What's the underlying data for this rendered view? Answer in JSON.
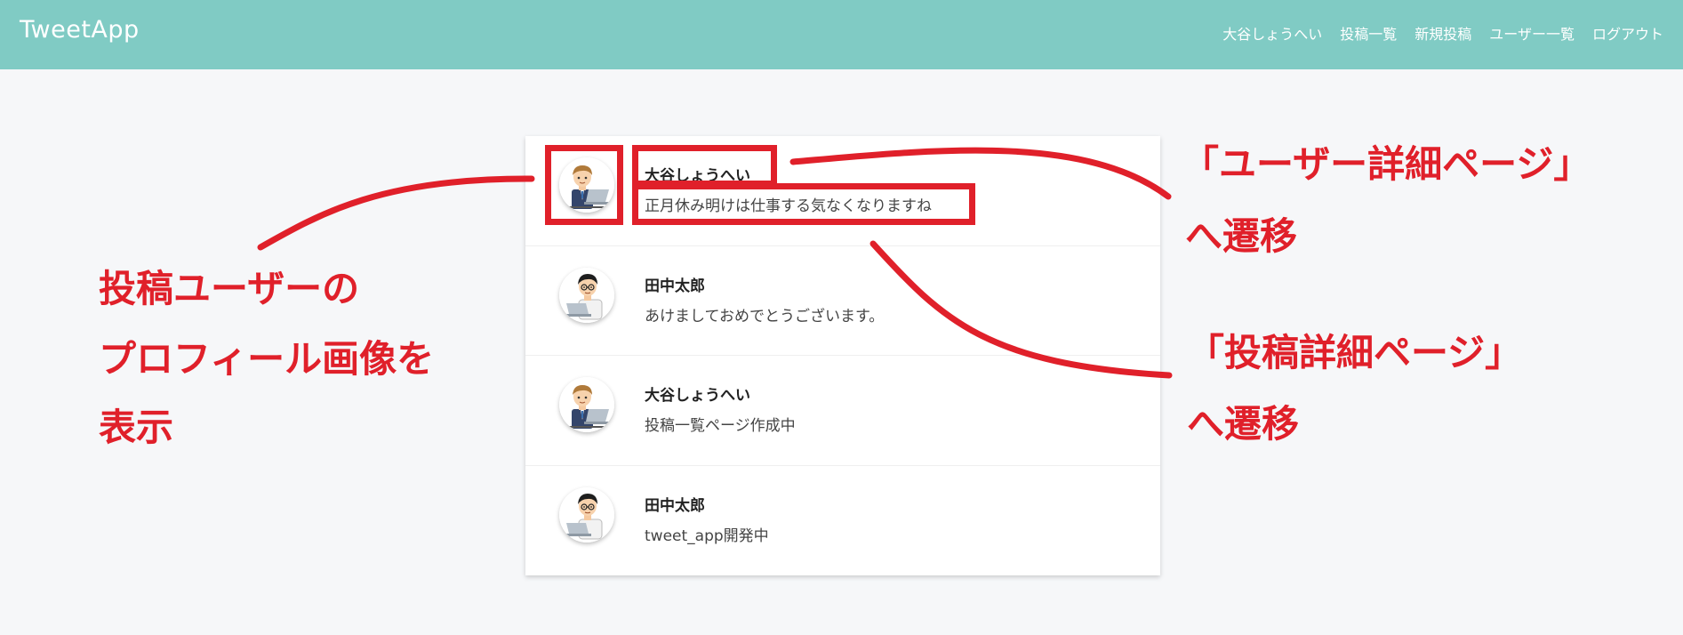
{
  "header": {
    "logo": "TweetApp",
    "nav": [
      "大谷しょうへい",
      "投稿一覧",
      "新規投稿",
      "ユーザー一覧",
      "ログアウト"
    ]
  },
  "posts": [
    {
      "user": "大谷しょうへい",
      "text": "正月休み明けは仕事する気なくなりますね",
      "avatar": "businessman-laptop-avatar"
    },
    {
      "user": "田中太郎",
      "text": "あけましておめでとうございます。",
      "avatar": "glasses-man-laptop-avatar"
    },
    {
      "user": "大谷しょうへい",
      "text": "投稿一覧ページ作成中",
      "avatar": "businessman-laptop-avatar"
    },
    {
      "user": "田中太郎",
      "text": "tweet_app開発中",
      "avatar": "glasses-man-laptop-avatar"
    }
  ],
  "annotations": {
    "left": [
      "投稿ユーザーの",
      "プロフィール画像を",
      "表示"
    ],
    "user_detail": [
      "「ユーザー詳細ページ」",
      "へ遷移"
    ],
    "post_detail": [
      "「投稿詳細ページ」",
      "へ遷移"
    ]
  },
  "colors": {
    "header": "#80cbc4",
    "annotation": "#e0202a",
    "background": "#f6f7f9"
  }
}
